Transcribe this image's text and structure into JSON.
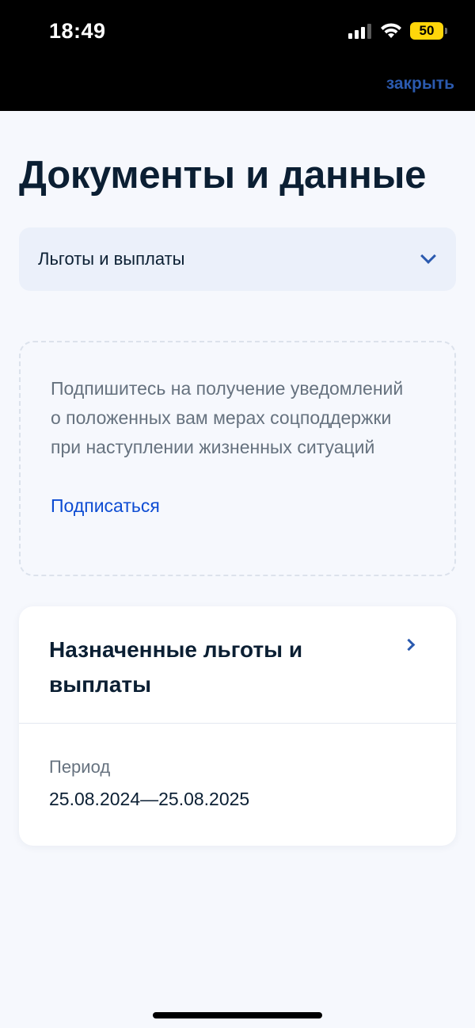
{
  "status_bar": {
    "time": "18:49",
    "battery": "50",
    "icons": [
      "signal-icon",
      "wifi-icon",
      "battery-icon"
    ]
  },
  "header": {
    "close_label": "закрыть"
  },
  "page": {
    "title": "Документы и данные"
  },
  "dropdown": {
    "selected": "Льготы и выплаты"
  },
  "promo": {
    "text": "Подпишитесь на получение уведомлений о положенных вам мерах соцподдержки при наступлении жизненных ситуаций",
    "link_label": "Подписаться"
  },
  "benefits_card": {
    "title": "Назначенные льготы и выплаты",
    "period_label": "Период",
    "period_value": "25.08.2024—25.08.2025"
  },
  "colors": {
    "accent": "#2b5aaf",
    "link": "#0d4cd3",
    "battery": "#ffd60a"
  }
}
